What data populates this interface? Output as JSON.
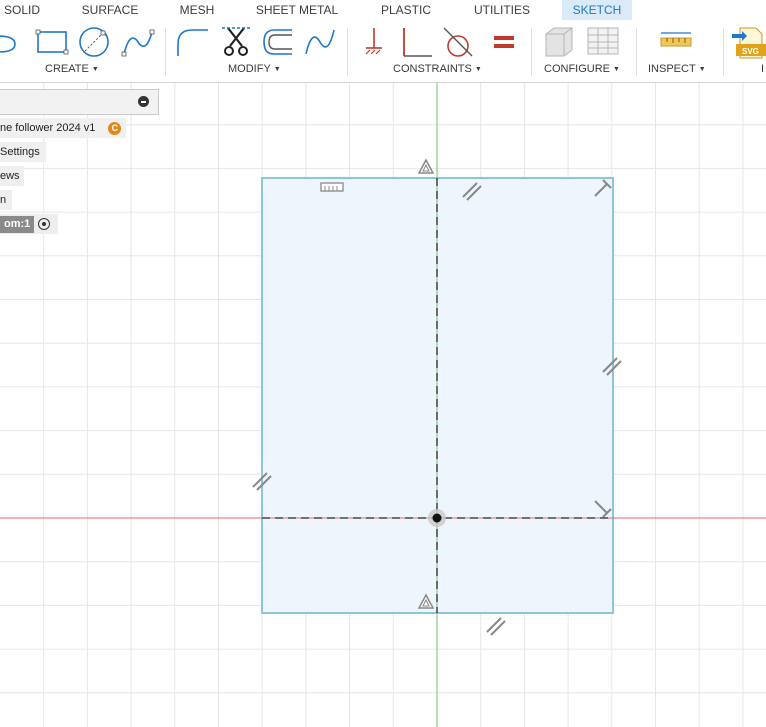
{
  "toolbar": {
    "tabs": [
      {
        "label": "SOLID"
      },
      {
        "label": "SURFACE"
      },
      {
        "label": "MESH"
      },
      {
        "label": "SHEET METAL"
      },
      {
        "label": "PLASTIC"
      },
      {
        "label": "UTILITIES"
      },
      {
        "label": "SKETCH",
        "active": true
      }
    ],
    "groups": {
      "create": "CREATE",
      "modify": "MODIFY",
      "constraints": "CONSTRAINTS",
      "configure": "CONFIGURE",
      "inspect": "INSPECT",
      "insert_partial": "I"
    },
    "insert_icon_text": "SVG",
    "accent_color": "#1f77c9"
  },
  "browser": {
    "document_name": "ne follower 2024 v1",
    "document_badge": "C",
    "settings_label": "Settings",
    "views_label": "ews",
    "item_partial": "n",
    "origin_tag": "om:1"
  },
  "canvas": {
    "x_axis_color": "#e06a6a",
    "y_axis_color": "#6ac46a",
    "profile_fill": "#eef5fc",
    "profile_stroke": "#8cc7d8",
    "grid_color": "#e6e6e6"
  }
}
